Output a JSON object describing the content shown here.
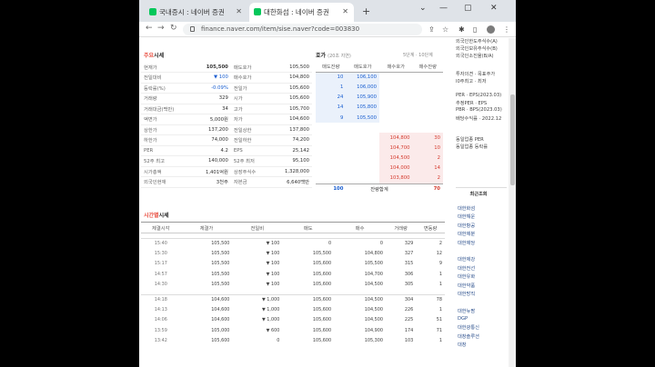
{
  "browser": {
    "tabs": [
      {
        "title": "국내증시 : 네이버 증권",
        "active": false
      },
      {
        "title": "대한화섬 : 네이버 증권",
        "active": true
      }
    ],
    "url": "finance.naver.com/item/sise.naver?code=003830"
  },
  "quote": {
    "title_accent": "주요",
    "title": "시세",
    "rows": [
      {
        "l1": "현재가",
        "v1": "105,500",
        "l2": "매도호가",
        "v2": "105,500"
      },
      {
        "l1": "전일대비",
        "v1": "▼ 100",
        "l2": "매수호가",
        "v2": "104,800"
      },
      {
        "l1": "등락률(%)",
        "v1": "-0.09%",
        "l2": "전일가",
        "v2": "105,600"
      },
      {
        "l1": "거래량",
        "v1": "329",
        "l2": "시가",
        "v2": "105,600"
      },
      {
        "l1": "거래대금(백만)",
        "v1": "34",
        "l2": "고가",
        "v2": "105,700"
      },
      {
        "l1": "액면가",
        "v1": "5,000원",
        "l2": "저가",
        "v2": "104,600"
      },
      {
        "l1": "상한가",
        "v1": "137,200",
        "l2": "전일상한",
        "v2": "137,800"
      },
      {
        "l1": "하한가",
        "v1": "74,000",
        "l2": "전일하한",
        "v2": "74,200"
      },
      {
        "l1": "PER",
        "v1": "4.2",
        "l2": "EPS",
        "v2": "25,142"
      },
      {
        "l1": "52주 최고",
        "v1": "140,000",
        "l2": "52주 최저",
        "v2": "95,100"
      },
      {
        "l1": "시가총액",
        "v1": "1,401억원",
        "l2": "상장주식수",
        "v2": "1,328,000"
      },
      {
        "l1": "외국인현재",
        "v1": "3천주",
        "l2": "자본금",
        "v2": "6,640백만"
      }
    ]
  },
  "orderbook": {
    "title": "호가",
    "subtitle": "(20초 지연)",
    "levels": "5단계 · 10단계",
    "headers": [
      "매도잔량",
      "매도호가",
      "매수호가",
      "매수잔량"
    ],
    "asks": [
      {
        "qty": "10",
        "price": "106,100"
      },
      {
        "qty": "1",
        "price": "106,000"
      },
      {
        "qty": "24",
        "price": "105,900"
      },
      {
        "qty": "14",
        "price": "105,800"
      },
      {
        "qty": "9",
        "price": "105,500"
      }
    ],
    "bids": [
      {
        "price": "104,800",
        "qty": "30"
      },
      {
        "price": "104,700",
        "qty": "10"
      },
      {
        "price": "104,500",
        "qty": "2"
      },
      {
        "price": "104,000",
        "qty": "14"
      },
      {
        "price": "103,800",
        "qty": "2"
      }
    ],
    "total_ask": "100",
    "total_label": "잔량합계",
    "total_bid": "70"
  },
  "history": {
    "title_accent": "시간별",
    "title": "시세",
    "headers": [
      "체결시각",
      "체결가",
      "전일비",
      "매도",
      "매수",
      "거래량",
      "변동량"
    ],
    "group1": [
      {
        "t": "15:40",
        "p": "105,500",
        "c": "▼ 100",
        "s": "0",
        "b": "0",
        "v": "329",
        "d": "2"
      },
      {
        "t": "15:30",
        "p": "105,500",
        "c": "▼ 100",
        "s": "105,500",
        "b": "104,800",
        "v": "327",
        "d": "12"
      },
      {
        "t": "15:17",
        "p": "105,500",
        "c": "▼ 100",
        "s": "105,600",
        "b": "105,500",
        "v": "315",
        "d": "9"
      },
      {
        "t": "14:57",
        "p": "105,500",
        "c": "▼ 100",
        "s": "105,600",
        "b": "104,700",
        "v": "306",
        "d": "1"
      },
      {
        "t": "14:30",
        "p": "105,500",
        "c": "▼ 100",
        "s": "105,600",
        "b": "104,500",
        "v": "305",
        "d": "1"
      }
    ],
    "group2": [
      {
        "t": "14:18",
        "p": "104,600",
        "c": "▼ 1,000",
        "s": "105,600",
        "b": "104,500",
        "v": "304",
        "d": "78"
      },
      {
        "t": "14:13",
        "p": "104,600",
        "c": "▼ 1,000",
        "s": "105,600",
        "b": "104,500",
        "v": "226",
        "d": "1"
      },
      {
        "t": "14:06",
        "p": "104,600",
        "c": "▼ 1,000",
        "s": "105,600",
        "b": "104,500",
        "v": "225",
        "d": "51"
      },
      {
        "t": "13:59",
        "p": "105,000",
        "c": "▼ 600",
        "s": "105,600",
        "b": "104,900",
        "v": "174",
        "d": "71"
      },
      {
        "t": "13:42",
        "p": "105,600",
        "c": "0",
        "s": "105,600",
        "b": "105,300",
        "v": "103",
        "d": "1"
      }
    ]
  },
  "sidebar": {
    "top": [
      "외국인한도주식수(A)",
      "외국인보유주식수(B)",
      "외국인소진율(B/A)"
    ],
    "opinion": [
      "투자의견 · 목표주가",
      "l0주최고 · 최저"
    ],
    "metrics": [
      "PER · EPS(2023.03)",
      "추정PER · EPS",
      "PBR · BPS(2023.03)",
      "배당수익률 · 2022.12"
    ],
    "industry": [
      "동일업종 PER",
      "동일업종 등락률"
    ],
    "recent_title": "최근조회",
    "recent": [
      "대한화섬",
      "대한해운",
      "대한항공",
      "대한제분",
      "대한제당",
      "",
      "대한제강",
      "대한전선",
      "대한유화",
      "대한약품",
      "대한방직",
      "",
      "대한뉴팜",
      "DGP",
      "대한광통신",
      "대창솔루션",
      "대창"
    ]
  }
}
